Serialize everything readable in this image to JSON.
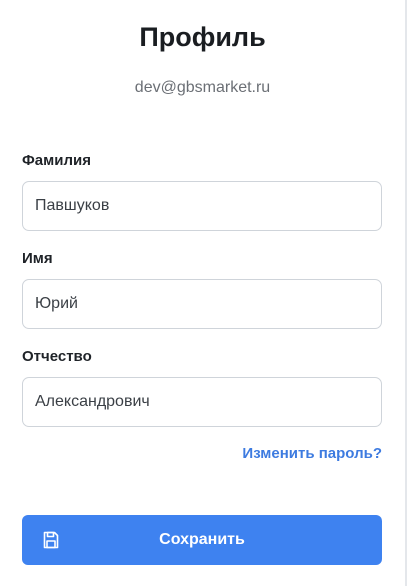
{
  "header": {
    "title": "Профиль",
    "email": "dev@gbsmarket.ru"
  },
  "form": {
    "last_name": {
      "label": "Фамилия",
      "value": "Павшуков"
    },
    "first_name": {
      "label": "Имя",
      "value": "Юрий"
    },
    "middle_name": {
      "label": "Отчество",
      "value": "Александрович"
    }
  },
  "change_password_link": "Изменить пароль?",
  "save_button": {
    "label": "Сохранить",
    "icon": "save-floppy-icon",
    "color": "#3e82f0"
  },
  "colors": {
    "accent": "#3e82f0",
    "link": "#3d7be0"
  }
}
